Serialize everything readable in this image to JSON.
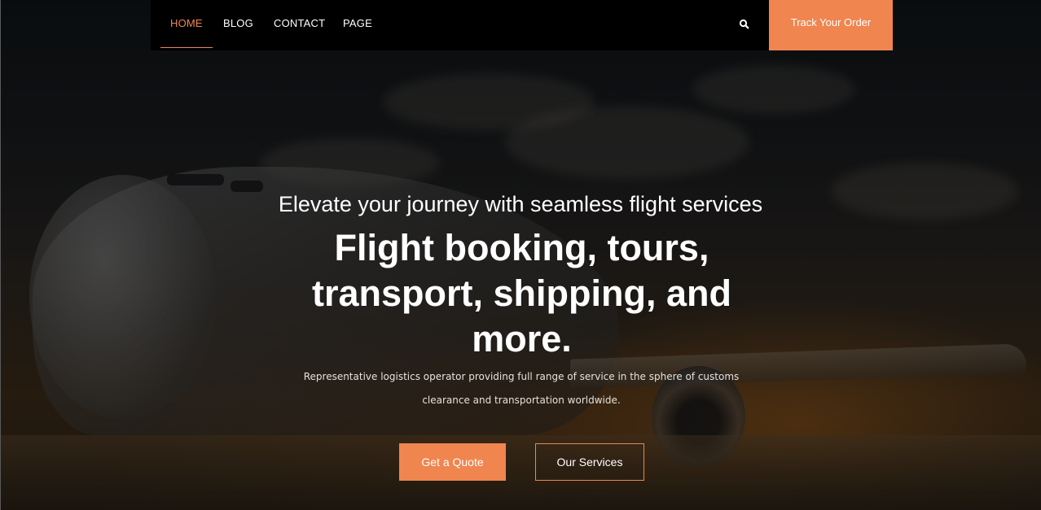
{
  "nav": {
    "items": [
      {
        "label": "HOME",
        "active": true
      },
      {
        "label": "BLOG",
        "active": false
      },
      {
        "label": "CONTACT",
        "active": false
      },
      {
        "label": "PAGE",
        "active": false
      }
    ],
    "search_icon": "search-icon",
    "track_label": "Track Your Order"
  },
  "hero": {
    "subtitle": "Elevate your journey with seamless flight services",
    "title": "Flight booking, tours, transport, shipping, and more.",
    "description": "Representative logistics operator providing full range of service in the sphere of customs clearance and transportation worldwide.",
    "primary_button": "Get a Quote",
    "secondary_button": "Our Services"
  },
  "colors": {
    "accent": "#f0854f",
    "nav_background": "#000000",
    "text": "#ffffff"
  }
}
